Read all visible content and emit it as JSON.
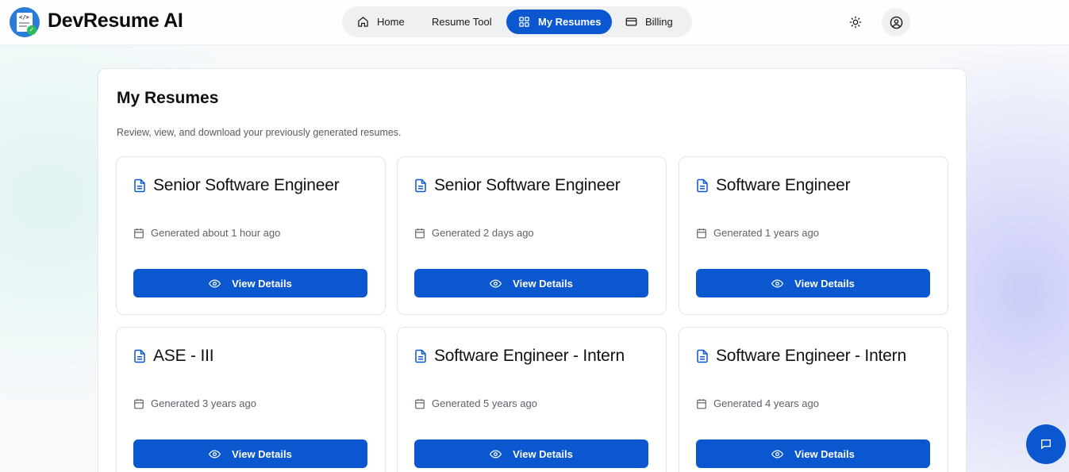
{
  "app": {
    "brand": "DevResume AI",
    "logo_code": "</>"
  },
  "nav": {
    "items": [
      {
        "label": "Home",
        "icon": "home-icon"
      },
      {
        "label": "Resume Tool",
        "icon": ""
      },
      {
        "label": "My Resumes",
        "icon": "grid-icon",
        "active": true
      },
      {
        "label": "Billing",
        "icon": "credit-card-icon"
      }
    ]
  },
  "header_actions": {
    "theme_icon": "sun-icon",
    "profile_icon": "user-circle-icon"
  },
  "page": {
    "title": "My Resumes",
    "subtitle": "Review, view, and download your previously generated resumes."
  },
  "resumes": [
    {
      "title": "Senior Software Engineer",
      "generated": "Generated about 1 hour ago",
      "button": "View Details"
    },
    {
      "title": "Senior Software Engineer",
      "generated": "Generated 2 days ago",
      "button": "View Details"
    },
    {
      "title": "Software Engineer",
      "generated": "Generated 1 years ago",
      "button": "View Details"
    },
    {
      "title": "ASE - III",
      "generated": "Generated 3 years ago",
      "button": "View Details"
    },
    {
      "title": "Software Engineer - Intern",
      "generated": "Generated 5 years ago",
      "button": "View Details"
    },
    {
      "title": "Software Engineer - Intern",
      "generated": "Generated 4 years ago",
      "button": "View Details"
    }
  ],
  "colors": {
    "primary": "#0b57d0",
    "nav_bg": "#eef0f2",
    "accent_glow": "#9696f5"
  }
}
